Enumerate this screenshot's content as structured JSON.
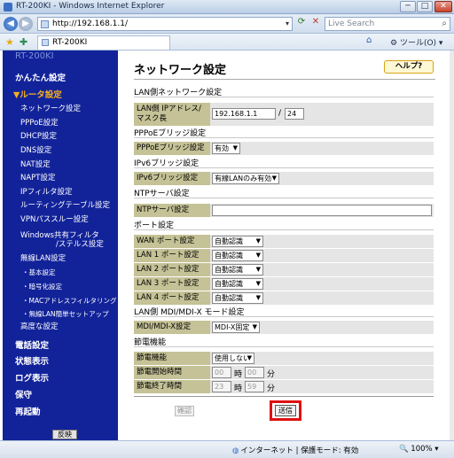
{
  "window": {
    "title": "RT-200KI - Windows Internet Explorer",
    "minimize": "─",
    "maximize": "□",
    "close": "✕"
  },
  "browser": {
    "back_glyph": "◀",
    "forward_glyph": "▶",
    "url": "http://192.168.1.1/",
    "refresh_glyph": "⟳",
    "stop_glyph": "✕",
    "search_placeholder": "Live Search",
    "tab_label": "RT-200KI",
    "tools_label": "ツール(O)",
    "icons": [
      "back-icon",
      "forward-icon",
      "refresh-icon",
      "stop-icon",
      "search-icon",
      "favorites-star-icon",
      "add-favorite-icon",
      "home-icon",
      "tools-gear-icon"
    ]
  },
  "sidebar": {
    "model": "RT-200KI",
    "easy_setup": "かんたん設定",
    "router_settings": "▼ルータ設定",
    "items": [
      "ネットワーク設定",
      "PPPoE設定",
      "DHCP設定",
      "DNS設定",
      "NAT設定",
      "NAPT設定",
      "IPフィルタ設定",
      "ルーティングテーブル設定",
      "VPNパススルー設定",
      "Windows共有フィルタ",
      "/ステルス設定",
      "無線LAN設定"
    ],
    "wireless_sub": [
      "・基本設定",
      "・暗号化設定",
      "・MACアドレスフィルタリング",
      "・無線LAN簡単セットアップ"
    ],
    "advanced": "高度な設定",
    "bottom": [
      "電話設定",
      "状態表示",
      "ログ表示",
      "保守",
      "再起動"
    ],
    "reflect_button": "反映",
    "bg_color": "#12239a",
    "active_color": "#f6b01e"
  },
  "main": {
    "title": "ネットワーク設定",
    "help_button": "ヘルプ?",
    "lan_section": "LAN側ネットワーク設定",
    "lan_ip_label": "LAN側 IPアドレス/\nマスク長",
    "lan_ip_value": "192.168.1.1",
    "lan_ip_sep": "/",
    "lan_mask_value": "24",
    "pppoe_section": "PPPoEブリッジ設定",
    "pppoe_label": "PPPoEブリッジ設定",
    "pppoe_value": "有効",
    "ipv6_section": "IPv6ブリッジ設定",
    "ipv6_label": "IPv6ブリッジ設定",
    "ipv6_value": "有線LANのみ有効",
    "ntp_section": "NTPサーバ設定",
    "ntp_label": "NTPサーバ設定",
    "ntp_value": "",
    "port_section": "ポート設定",
    "ports": [
      {
        "label": "WAN ポート設定",
        "value": "自動認識"
      },
      {
        "label": "LAN 1 ポート設定",
        "value": "自動認識"
      },
      {
        "label": "LAN 2 ポート設定",
        "value": "自動認識"
      },
      {
        "label": "LAN 3 ポート設定",
        "value": "自動認識"
      },
      {
        "label": "LAN 4 ポート設定",
        "value": "自動認識"
      }
    ],
    "mdi_section": "LAN側 MDI/MDI-X モード設定",
    "mdi_label": "MDI/MDI-X設定",
    "mdi_value": "MDI-X固定",
    "power_section": "節電機能",
    "power_label": "節電機能",
    "power_value": "使用しない",
    "power_start_label": "節電開始時間",
    "power_start_hour": "00",
    "power_start_min": "00",
    "power_end_label": "節電終了時間",
    "power_end_hour": "23",
    "power_end_min": "59",
    "hour_unit": "時",
    "min_unit": "分",
    "confirm_button": "確認",
    "send_button": "送信",
    "highlight_color": "#e01010",
    "label_bg": "#c4c296"
  },
  "status": {
    "zone": "インターネット | 保護モード: 有効",
    "zoom": "100%"
  }
}
